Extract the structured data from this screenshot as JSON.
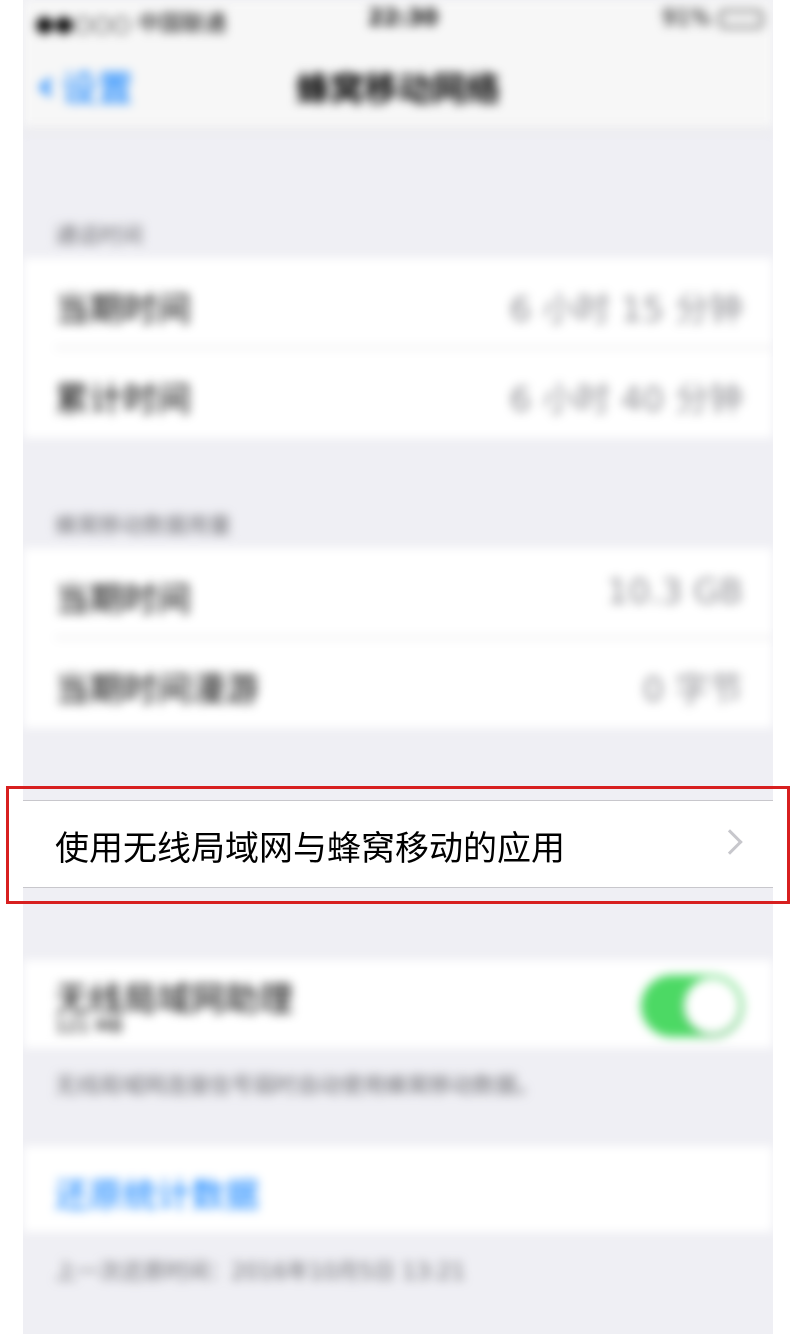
{
  "status_bar": {
    "carrier": "●●○○○ 中国联通",
    "time": "22:30",
    "battery": "91%",
    "battery_level": 0.91
  },
  "nav": {
    "back_label": "设置",
    "title": "蜂窝移动网络"
  },
  "call_time": {
    "header": "通话时间",
    "rows": [
      {
        "label": "当期时间",
        "value": "6 小时 15 分钟"
      },
      {
        "label": "累计时间",
        "value": "6 小时 40 分钟"
      }
    ]
  },
  "cellular_data": {
    "header": "蜂窝移动数据用量",
    "rows": [
      {
        "label": "当期时间",
        "value": "10.3 GB"
      },
      {
        "label": "当期时间漫游",
        "value": "0 字节"
      }
    ]
  },
  "apps_cell": {
    "label": "使用无线局域网与蜂窝移动的应用"
  },
  "wifi_assist": {
    "label": "无线局域网助理",
    "usage": "121 MB",
    "enabled": true,
    "footer": "无线局域网连接信号弱时自动使用蜂窝移动数据。"
  },
  "reset": {
    "label": "还原统计数据",
    "footer": "上一次还原时间：2016年10月5日 13:21"
  },
  "colors": {
    "accent": "#007aff",
    "toggle_on": "#4cd964",
    "highlight": "#d71f1f",
    "background": "#efeff4"
  }
}
